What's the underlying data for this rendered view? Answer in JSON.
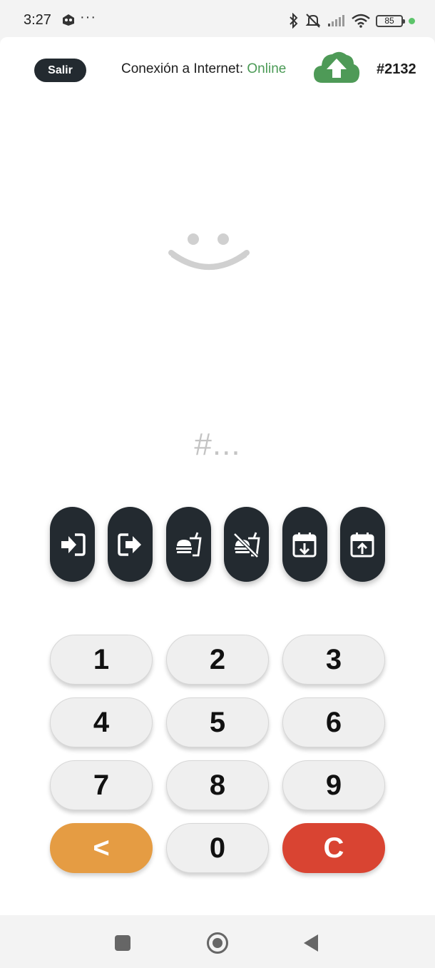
{
  "status_bar": {
    "time": "3:27",
    "more": "···",
    "battery": "85",
    "icons": [
      "app-notification-icon",
      "bluetooth-icon",
      "mute-icon",
      "signal-icon",
      "wifi-icon",
      "battery-icon"
    ]
  },
  "header": {
    "exit_label": "Salir",
    "connection_label": "Conexión a Internet:",
    "connection_status": "Online",
    "device_id": "#2132",
    "sync_icon": "cloud-upload-icon"
  },
  "display": {
    "code_placeholder": "#...",
    "face_icon": "smiley-icon"
  },
  "actions": [
    {
      "name": "check-in",
      "icon": "sign-in-icon"
    },
    {
      "name": "check-out",
      "icon": "sign-out-icon"
    },
    {
      "name": "break-start",
      "icon": "food-icon"
    },
    {
      "name": "break-end",
      "icon": "no-food-icon"
    },
    {
      "name": "shift-in",
      "icon": "calendar-down-icon"
    },
    {
      "name": "shift-out",
      "icon": "calendar-up-icon"
    }
  ],
  "keypad": {
    "keys": [
      "1",
      "2",
      "3",
      "4",
      "5",
      "6",
      "7",
      "8",
      "9",
      "<",
      "0",
      "C"
    ]
  },
  "colors": {
    "dark": "#232a30",
    "online": "#4a9a55",
    "cloud": "#4e9a57",
    "backspace": "#e59c43",
    "clear": "#d94432",
    "key_bg": "#efefef",
    "placeholder": "#c4c4c4"
  },
  "nav_bar": {
    "buttons": [
      "recents-button",
      "home-button",
      "back-button"
    ]
  }
}
